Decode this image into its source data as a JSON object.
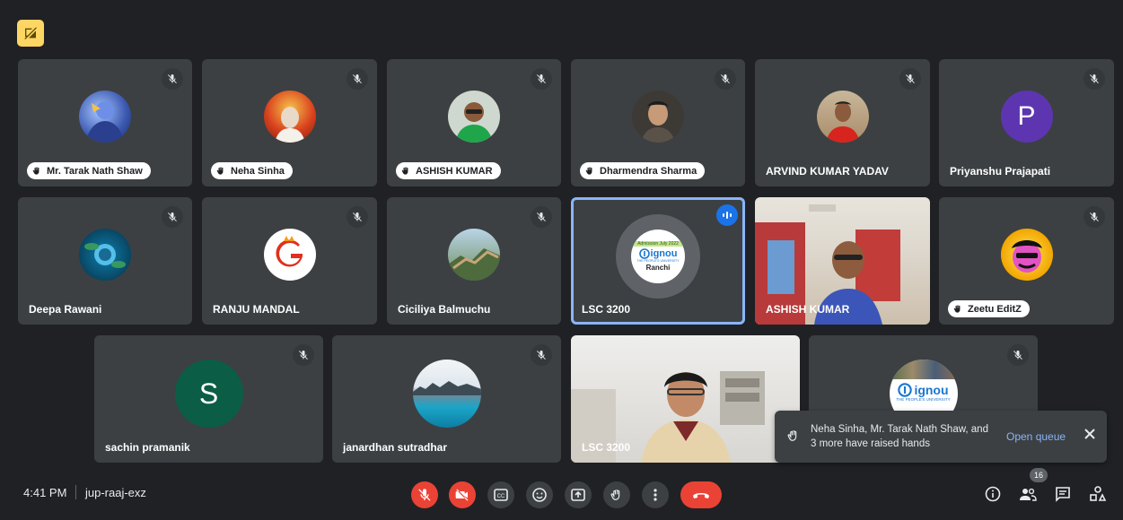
{
  "colors": {
    "background": "#202124",
    "tile": "#3c4043",
    "active_border": "#8ab4f8",
    "end_call": "#ea4335",
    "accent_link": "#8ab4f8"
  },
  "row1": [
    {
      "name": "Mr. Tarak Nath Shaw",
      "hand_raised": true,
      "muted": true
    },
    {
      "name": "Neha Sinha",
      "hand_raised": true,
      "muted": true
    },
    {
      "name": "ASHISH KUMAR",
      "hand_raised": true,
      "muted": true
    },
    {
      "name": "Dharmendra Sharma",
      "hand_raised": true,
      "muted": true
    },
    {
      "name": "ARVIND KUMAR YADAV",
      "hand_raised": false,
      "muted": true
    },
    {
      "name": "Priyanshu Prajapati",
      "initial": "P",
      "hand_raised": false,
      "muted": true
    }
  ],
  "row2": [
    {
      "name": "Deepa Rawani",
      "muted": true
    },
    {
      "name": "RANJU MANDAL",
      "muted": true
    },
    {
      "name": "Ciciliya Balmuchu",
      "muted": true
    },
    {
      "name": "LSC 3200",
      "speaking": true
    },
    {
      "name": "ASHISH KUMAR",
      "video": true
    },
    {
      "name": "Zeetu EditZ",
      "hand_raised": true,
      "muted": true
    }
  ],
  "row3": [
    {
      "name": "sachin pramanik",
      "initial": "S",
      "muted": true
    },
    {
      "name": "janardhan sutradhar",
      "muted": true
    },
    {
      "name": "LSC 3200",
      "video": true
    },
    {
      "name": "",
      "muted": true
    }
  ],
  "logo": {
    "banner": "Admission July 2022",
    "brand": "ignou",
    "tagline": "THE PEOPLE'S UNIVERSITY",
    "city": "Ranchi"
  },
  "toast": {
    "text": "Neha Sinha, Mr. Tarak Nath Shaw, and 3 more have raised hands",
    "link": "Open queue"
  },
  "bottom": {
    "time": "4:41 PM",
    "code": "jup-raaj-exz",
    "participant_count": "16"
  },
  "icons": [
    "mic-off-icon",
    "camera-off-icon",
    "captions-icon",
    "emoji-icon",
    "present-icon",
    "raise-hand-icon",
    "more-options-icon",
    "end-call-icon",
    "info-icon",
    "people-icon",
    "chat-icon",
    "activities-icon"
  ]
}
